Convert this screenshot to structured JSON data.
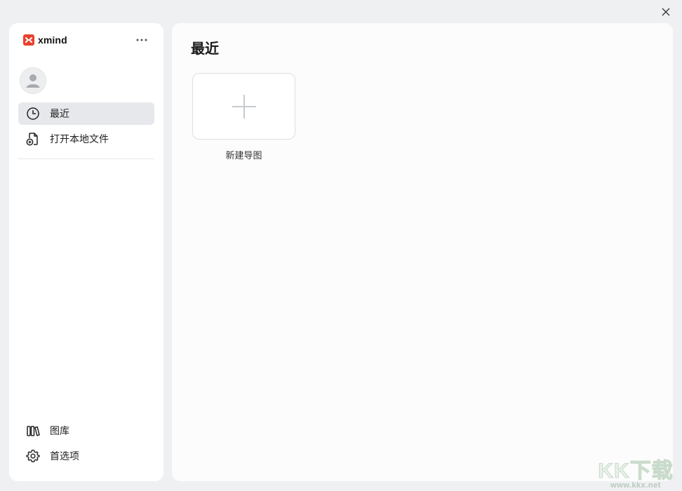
{
  "window": {
    "close_icon": "close-icon"
  },
  "sidebar": {
    "brand": {
      "name": "xmind",
      "logo_icon": "xmind-logo-icon",
      "logo_color": "#e8432e"
    },
    "more_icon": "more-horizontal-icon",
    "avatar_icon": "user-avatar-icon",
    "nav_items": [
      {
        "label": "最近",
        "icon": "clock-icon",
        "active": true
      },
      {
        "label": "打开本地文件",
        "icon": "open-local-file-icon",
        "active": false
      }
    ],
    "bottom_items": [
      {
        "label": "图库",
        "icon": "library-icon"
      },
      {
        "label": "首选项",
        "icon": "gear-icon"
      }
    ]
  },
  "main": {
    "title": "最近",
    "new_map": {
      "label": "新建导图",
      "icon": "plus-icon"
    }
  },
  "watermark": {
    "text": "KK下载",
    "url": "www.kkx.net"
  },
  "colors": {
    "background": "#eef0f2",
    "panel": "#ffffff",
    "active_item": "#e6e8eb",
    "accent": "#e8432e"
  }
}
